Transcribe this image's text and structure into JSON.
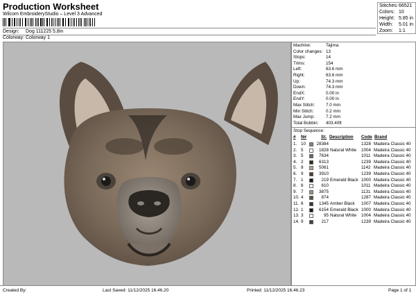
{
  "header": {
    "title": "Production Worksheet",
    "software": "Wilcom EmbroideryStudio – Level 3 Advanced",
    "barcode_tail": ",",
    "design_label": "Design:",
    "design_value": "Dog 111225 5,8in",
    "colorway_label": "Colorway:",
    "colorway_value": "Colorway 1"
  },
  "summary": {
    "stitches_label": "Stitches:",
    "stitches": "66521",
    "colors_label": "Colors:",
    "colors": "10",
    "height_label": "Height:",
    "height": "5.85 in",
    "width_label": "Width:",
    "width": "5.01 in",
    "zoom_label": "Zoom:",
    "zoom": "1:1"
  },
  "machine": {
    "rows": [
      {
        "label": "Machine:",
        "value": "Tajima"
      },
      {
        "label": "Color changes:",
        "value": "13"
      },
      {
        "label": "Stops:",
        "value": "14"
      },
      {
        "label": "Trims:",
        "value": "154"
      },
      {
        "label": "Left:",
        "value": "63.6 mm"
      },
      {
        "label": "Right:",
        "value": "63.6 mm"
      },
      {
        "label": "Up:",
        "value": "74.3 mm"
      },
      {
        "label": "Down:",
        "value": "74.3 mm"
      },
      {
        "label": "EndX:",
        "value": "0.00 in"
      },
      {
        "label": "EndY:",
        "value": "0.00 in"
      },
      {
        "label": "Max Stitch:",
        "value": "7.0 mm"
      },
      {
        "label": "Min Stitch:",
        "value": "0.2 mm"
      },
      {
        "label": "Max Jump:",
        "value": "7.2 mm"
      },
      {
        "label": "Total Bobbin:",
        "value": "403.40ft"
      }
    ]
  },
  "stop_sequence": {
    "title": "Stop Sequence:",
    "columns": [
      "#",
      "N#",
      "St.",
      "Description",
      "Code",
      "Brand"
    ],
    "rows": [
      {
        "n": "1.",
        "needle": "10",
        "color": "#8f8071",
        "st": "28384",
        "desc": "",
        "code": "1328",
        "brand": "Madeira Classic 40"
      },
      {
        "n": "2.",
        "needle": "5",
        "color": "#ffffff",
        "st": "1828",
        "desc": "Natural White",
        "code": "1004",
        "brand": "Madeira Classic 40"
      },
      {
        "n": "3.",
        "needle": "5",
        "color": "#6f6660",
        "st": "7634",
        "desc": "",
        "code": "1011",
        "brand": "Madeira Classic 40"
      },
      {
        "n": "4.",
        "needle": "2",
        "color": "#2e2a26",
        "st": "6313",
        "desc": "",
        "code": "1239",
        "brand": "Madeira Classic 40"
      },
      {
        "n": "5.",
        "needle": "8",
        "color": "#b7a48f",
        "st": "5061",
        "desc": "",
        "code": "1142",
        "brand": "Madeira Classic 40"
      },
      {
        "n": "6.",
        "needle": "9",
        "color": "#4a3f37",
        "st": "3910",
        "desc": "",
        "code": "1239",
        "brand": "Madeira Classic 40"
      },
      {
        "n": "7.",
        "needle": "1",
        "color": "#1a1a1a",
        "st": "219",
        "desc": "Emerald Black",
        "code": "1000",
        "brand": "Madeira Classic 40"
      },
      {
        "n": "8.",
        "needle": "6",
        "color": "#ffffff",
        "st": "610",
        "desc": "",
        "code": "1011",
        "brand": "Madeira Classic 40"
      },
      {
        "n": "9.",
        "needle": "7",
        "color": "#9b9186",
        "st": "3875",
        "desc": "",
        "code": "1131",
        "brand": "Madeira Classic 40"
      },
      {
        "n": "10.",
        "needle": "4",
        "color": "#5a524b",
        "st": "874",
        "desc": "",
        "code": "1287",
        "brand": "Madeira Classic 40"
      },
      {
        "n": "11.",
        "needle": "6",
        "color": "#3a3632",
        "st": "1345",
        "desc": "Amber Black",
        "code": "1007",
        "brand": "Madeira Classic 40"
      },
      {
        "n": "12.",
        "needle": "1",
        "color": "#1a1a1a",
        "st": "6154",
        "desc": "Emerald Black",
        "code": "1000",
        "brand": "Madeira Classic 40"
      },
      {
        "n": "13.",
        "needle": "3",
        "color": "#ffffff",
        "st": "95",
        "desc": "Natural White",
        "code": "1004",
        "brand": "Madeira Classic 40"
      },
      {
        "n": "14.",
        "needle": "9",
        "color": "#4a3f37",
        "st": "217",
        "desc": "",
        "code": "1239",
        "brand": "Madeira Classic 40"
      }
    ]
  },
  "footer": {
    "created_by": "Created By:",
    "last_saved": "Last Saved: 11/12/2025 16.46.20",
    "printed": "Printed: 11/12/2025 16.46.23",
    "page": "Page 1 of 1"
  }
}
